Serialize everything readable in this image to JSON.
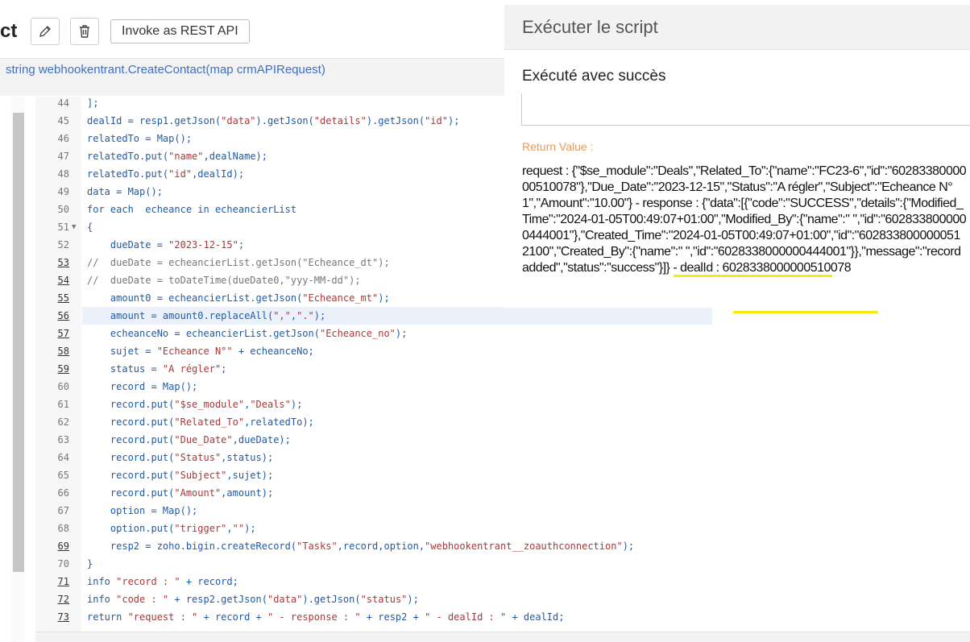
{
  "toolbar": {
    "title_fragment": "ct",
    "rest_button_label": "Invoke as REST API"
  },
  "signature": "string webhookentrant.CreateContact(map crmAPIRequest)",
  "editor": {
    "lines": [
      {
        "n": "44",
        "u": false,
        "fold": "",
        "code": [
          [
            "k",
            "];"
          ]
        ]
      },
      {
        "n": "45",
        "u": false,
        "fold": "",
        "code": [
          [
            "k",
            "dealId = resp1.getJson("
          ],
          [
            "s",
            "\"data\""
          ],
          [
            "k",
            ").getJson("
          ],
          [
            "s",
            "\"details\""
          ],
          [
            "k",
            ").getJson("
          ],
          [
            "s",
            "\"id\""
          ],
          [
            "k",
            ");"
          ]
        ]
      },
      {
        "n": "46",
        "u": false,
        "fold": "",
        "code": [
          [
            "k",
            "relatedTo = Map();"
          ]
        ]
      },
      {
        "n": "47",
        "u": false,
        "fold": "",
        "code": [
          [
            "k",
            "relatedTo.put("
          ],
          [
            "s",
            "\"name\""
          ],
          [
            "k",
            ",dealName);"
          ]
        ]
      },
      {
        "n": "48",
        "u": false,
        "fold": "",
        "code": [
          [
            "k",
            "relatedTo.put("
          ],
          [
            "s",
            "\"id\""
          ],
          [
            "k",
            ",dealId);"
          ]
        ]
      },
      {
        "n": "49",
        "u": false,
        "fold": "",
        "code": [
          [
            "k",
            "data = Map();"
          ]
        ]
      },
      {
        "n": "50",
        "u": false,
        "fold": "",
        "code": [
          [
            "k",
            "for each  echeance in echeancierList"
          ]
        ]
      },
      {
        "n": "51",
        "u": false,
        "fold": "▼",
        "code": [
          [
            "k",
            "{"
          ]
        ]
      },
      {
        "n": "52",
        "u": false,
        "fold": "",
        "code": [
          [
            "k",
            "    dueDate = "
          ],
          [
            "s",
            "\"2023-12-15\""
          ],
          [
            "k",
            ";"
          ]
        ]
      },
      {
        "n": "53",
        "u": true,
        "fold": "",
        "code": [
          [
            "c",
            "//  dueDate = echeancierList.getJson(\"Echeance_dt\");"
          ]
        ]
      },
      {
        "n": "54",
        "u": true,
        "fold": "",
        "code": [
          [
            "c",
            "//  dueDate = toDateTime(dueDate0,\"yyy-MM-dd\");"
          ]
        ]
      },
      {
        "n": "55",
        "u": true,
        "fold": "",
        "code": [
          [
            "k",
            "    amount0 = echeancierList.getJson("
          ],
          [
            "s",
            "\"Echeance_mt\""
          ],
          [
            "k",
            ");"
          ]
        ]
      },
      {
        "n": "56",
        "u": true,
        "fold": "",
        "code": [
          [
            "k",
            "    amount = amount0.replaceAll("
          ],
          [
            "s",
            "\",\""
          ],
          [
            "k",
            ","
          ],
          [
            "s",
            "\".\""
          ],
          [
            "k",
            ");"
          ]
        ]
      },
      {
        "n": "57",
        "u": true,
        "fold": "",
        "code": [
          [
            "k",
            "    echeanceNo = echeancierList.getJson("
          ],
          [
            "s",
            "\"Echeance_no\""
          ],
          [
            "k",
            ");"
          ]
        ]
      },
      {
        "n": "58",
        "u": true,
        "fold": "",
        "code": [
          [
            "k",
            "    sujet = "
          ],
          [
            "s",
            "\"Echeance N°\""
          ],
          [
            "k",
            " + echeanceNo;"
          ]
        ]
      },
      {
        "n": "59",
        "u": true,
        "fold": "",
        "code": [
          [
            "k",
            "    status = "
          ],
          [
            "s",
            "\"A régler\""
          ],
          [
            "k",
            ";"
          ]
        ]
      },
      {
        "n": "60",
        "u": false,
        "fold": "",
        "code": [
          [
            "k",
            "    record = Map();"
          ]
        ]
      },
      {
        "n": "61",
        "u": false,
        "fold": "",
        "code": [
          [
            "k",
            "    record.put("
          ],
          [
            "s",
            "\"$se_module\""
          ],
          [
            "k",
            ","
          ],
          [
            "s",
            "\"Deals\""
          ],
          [
            "k",
            ");"
          ]
        ]
      },
      {
        "n": "62",
        "u": false,
        "fold": "",
        "code": [
          [
            "k",
            "    record.put("
          ],
          [
            "s",
            "\"Related_To\""
          ],
          [
            "k",
            ",relatedTo);"
          ]
        ]
      },
      {
        "n": "63",
        "u": false,
        "fold": "",
        "code": [
          [
            "k",
            "    record.put("
          ],
          [
            "s",
            "\"Due_Date\""
          ],
          [
            "k",
            ",dueDate);"
          ]
        ]
      },
      {
        "n": "64",
        "u": false,
        "fold": "",
        "code": [
          [
            "k",
            "    record.put("
          ],
          [
            "s",
            "\"Status\""
          ],
          [
            "k",
            ",status);"
          ]
        ]
      },
      {
        "n": "65",
        "u": false,
        "fold": "",
        "code": [
          [
            "k",
            "    record.put("
          ],
          [
            "s",
            "\"Subject\""
          ],
          [
            "k",
            ",sujet);"
          ]
        ]
      },
      {
        "n": "66",
        "u": false,
        "fold": "",
        "code": [
          [
            "k",
            "    record.put("
          ],
          [
            "s",
            "\"Amount\""
          ],
          [
            "k",
            ",amount);"
          ]
        ]
      },
      {
        "n": "67",
        "u": false,
        "fold": "",
        "code": [
          [
            "k",
            "    option = Map();"
          ]
        ]
      },
      {
        "n": "68",
        "u": false,
        "fold": "",
        "code": [
          [
            "k",
            "    option.put("
          ],
          [
            "s",
            "\"trigger\""
          ],
          [
            "k",
            ","
          ],
          [
            "s",
            "\"\""
          ],
          [
            "k",
            ");"
          ]
        ]
      },
      {
        "n": "69",
        "u": true,
        "fold": "",
        "code": [
          [
            "k",
            "    resp2 = zoho.bigin.createRecord("
          ],
          [
            "s",
            "\"Tasks\""
          ],
          [
            "k",
            ",record,option,"
          ],
          [
            "s",
            "\"webhookentrant__zoauthconnection\""
          ],
          [
            "k",
            ");"
          ]
        ]
      },
      {
        "n": "70",
        "u": false,
        "fold": "",
        "code": [
          [
            "k",
            "}"
          ]
        ]
      },
      {
        "n": "71",
        "u": true,
        "fold": "",
        "code": [
          [
            "k",
            "info "
          ],
          [
            "s",
            "\"record : \""
          ],
          [
            "k",
            " + record;"
          ]
        ]
      },
      {
        "n": "72",
        "u": true,
        "fold": "",
        "code": [
          [
            "k",
            "info "
          ],
          [
            "s",
            "\"code : \""
          ],
          [
            "k",
            " + resp2.getJson("
          ],
          [
            "s",
            "\"data\""
          ],
          [
            "k",
            ").getJson("
          ],
          [
            "s",
            "\"status\""
          ],
          [
            "k",
            ");"
          ]
        ]
      },
      {
        "n": "73",
        "u": true,
        "fold": "",
        "code": [
          [
            "k",
            "return "
          ],
          [
            "s",
            "\"request : \""
          ],
          [
            "k",
            " + record + "
          ],
          [
            "s",
            "\" - response : \""
          ],
          [
            "k",
            " + resp2 + "
          ],
          [
            "s",
            "\" - dealId : \""
          ],
          [
            "k",
            " + dealId;"
          ]
        ]
      }
    ]
  },
  "panel": {
    "title": "Exécuter le script",
    "status": "Exécuté avec succès",
    "return_label": "Return Value :",
    "return_value": "request : {\"$se_module\":\"Deals\",\"Related_To\":{\"name\":\"FC23-6\",\"id\":\"6028338000000510078\"},\"Due_Date\":\"2023-12-15\",\"Status\":\"A régler\",\"Subject\":\"Echeance N°1\",\"Amount\":\"10.00\"} - response : {\"data\":[{\"code\":\"SUCCESS\",\"details\":{\"Modified_Time\":\"2024-01-05T00:49:07+01:00\",\"Modified_By\":{\"name\":\"            \",\"id\":\"6028338000000444001\"},\"Created_Time\":\"2024-01-05T00:49:07+01:00\",\"id\":\"6028338000000512100\",\"Created_By\":{\"name\":\"            \",\"id\":\"6028338000000444001\"}},\"message\":\"record added\",\"status\":\"success\"}]} - dealId : 6028338000000510078",
    "highlight_color": "#f6ea16"
  }
}
